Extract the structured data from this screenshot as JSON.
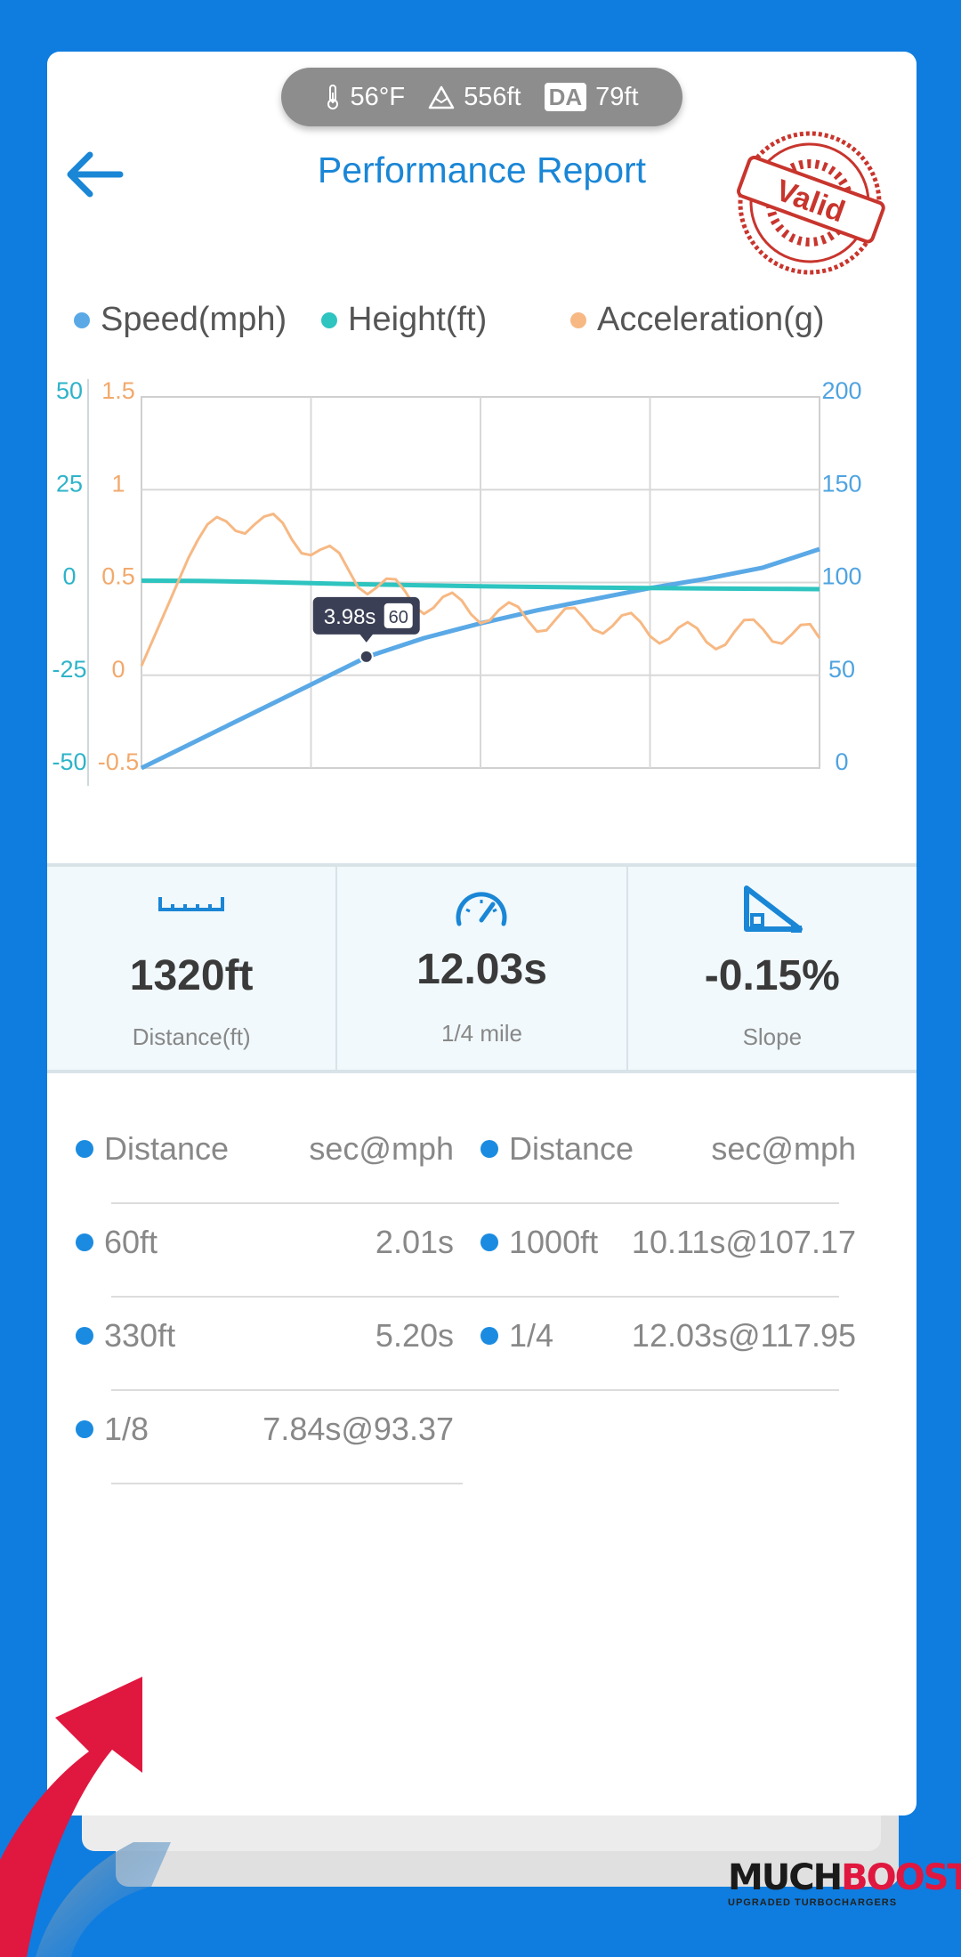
{
  "conditions": {
    "temperature": "56°F",
    "altitude": "556ft",
    "da_badge": "DA",
    "density_altitude": "79ft"
  },
  "header": {
    "title": "Performance Report",
    "stamp_text": "Valid"
  },
  "legend": [
    {
      "label": "Speed(mph)",
      "color": "#5aa9e6"
    },
    {
      "label": "Height(ft)",
      "color": "#2ec4c0"
    },
    {
      "label": "Acceleration(g)",
      "color": "#f7b883"
    }
  ],
  "chart_data": {
    "type": "line",
    "x": [
      0,
      1,
      2,
      3,
      4,
      5,
      6,
      7,
      8,
      9,
      10,
      11,
      12
    ],
    "series": [
      {
        "name": "Speed(mph)",
        "axis": "right-outer",
        "color": "#5aa9e6",
        "values": [
          0,
          15,
          30,
          45,
          60,
          70,
          78,
          85,
          91,
          97,
          102,
          108,
          118
        ]
      },
      {
        "name": "Height(ft)",
        "axis": "left-outer",
        "color": "#2ec4c0",
        "values": [
          0.5,
          0.4,
          0.2,
          -0.2,
          -0.5,
          -0.8,
          -1,
          -1.2,
          -1.4,
          -1.5,
          -1.6,
          -1.7,
          -1.8
        ]
      },
      {
        "name": "Acceleration(g)",
        "axis": "left-inner",
        "color": "#f7b883",
        "values": [
          0.05,
          0.75,
          0.85,
          0.7,
          0.5,
          0.4,
          0.35,
          0.3,
          0.3,
          0.25,
          0.2,
          0.25,
          0.2
        ]
      }
    ],
    "axes": {
      "left_outer": {
        "ticks": [
          "50",
          "25",
          "0",
          "-25",
          "-50"
        ],
        "range": [
          -50,
          50
        ]
      },
      "left_inner": {
        "ticks": [
          "1.5",
          "1",
          "0.5",
          "0",
          "-0.5"
        ],
        "range": [
          -0.5,
          1.5
        ]
      },
      "right": {
        "ticks": [
          "200",
          "150",
          "100",
          "50",
          "0"
        ],
        "range": [
          0,
          200
        ]
      }
    },
    "tooltip": {
      "time": "3.98s",
      "value": "60",
      "x": 3.98,
      "y": 60
    },
    "grid": true,
    "xlim": [
      0,
      12
    ]
  },
  "stats": [
    {
      "icon": "ruler-icon",
      "value": "1320ft",
      "label": "Distance(ft)"
    },
    {
      "icon": "speedometer-icon",
      "value": "12.03s",
      "label": "1/4 mile"
    },
    {
      "icon": "slope-icon",
      "value": "-0.15%",
      "label": "Slope"
    }
  ],
  "splits": {
    "left": [
      {
        "name": "Distance",
        "value": "sec@mph"
      },
      {
        "name": "60ft",
        "value": "2.01s"
      },
      {
        "name": "330ft",
        "value": "5.20s"
      },
      {
        "name": "1/8",
        "value": "7.84s@93.37"
      }
    ],
    "right": [
      {
        "name": "Distance",
        "value": "sec@mph"
      },
      {
        "name": "1000ft",
        "value": "10.11s@107.17"
      },
      {
        "name": "1/4",
        "value": "12.03s@117.95"
      }
    ]
  },
  "brand": {
    "name_left": "MUCH",
    "name_right": "BOOST",
    "tagline": "UPGRADED TURBOCHARGERS"
  },
  "colors": {
    "background": "#0f7ddf",
    "accent": "#1a86d6",
    "stamp": "#c8352d",
    "dot": "#1a8be0"
  }
}
